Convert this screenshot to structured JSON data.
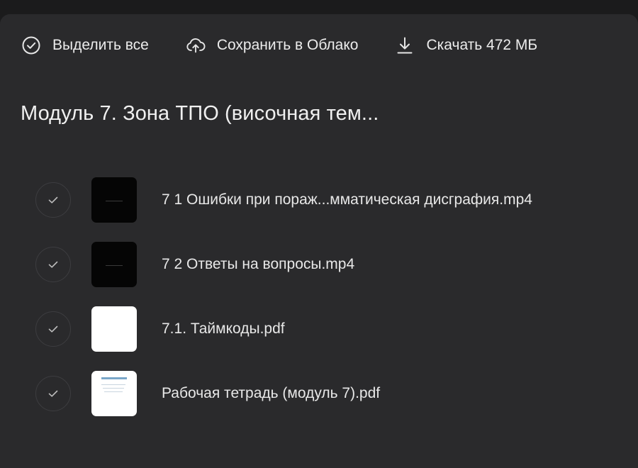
{
  "toolbar": {
    "select_all_label": "Выделить все",
    "save_cloud_label": "Сохранить в Облако",
    "download_label": "Скачать 472 МБ"
  },
  "folder": {
    "title": "Модуль 7. Зона ТПО (височная тем..."
  },
  "files": [
    {
      "name": "7 1 Ошибки при пораж...мматическая дисграфия.mp4",
      "thumb": "video"
    },
    {
      "name": "7 2 Ответы на вопросы.mp4",
      "thumb": "video"
    },
    {
      "name": "7.1. Таймкоды.pdf",
      "thumb": "blank"
    },
    {
      "name": "Рабочая тетрадь (модуль 7).pdf",
      "thumb": "doc"
    }
  ],
  "icons": {
    "select_all": "check-circle-icon",
    "save_cloud": "cloud-upload-icon",
    "download": "download-icon",
    "row_check": "checkmark-icon"
  },
  "colors": {
    "background": "#1b1b1c",
    "panel": "#2a2a2c",
    "text": "#ececec",
    "check_border": "#3d3d40"
  }
}
